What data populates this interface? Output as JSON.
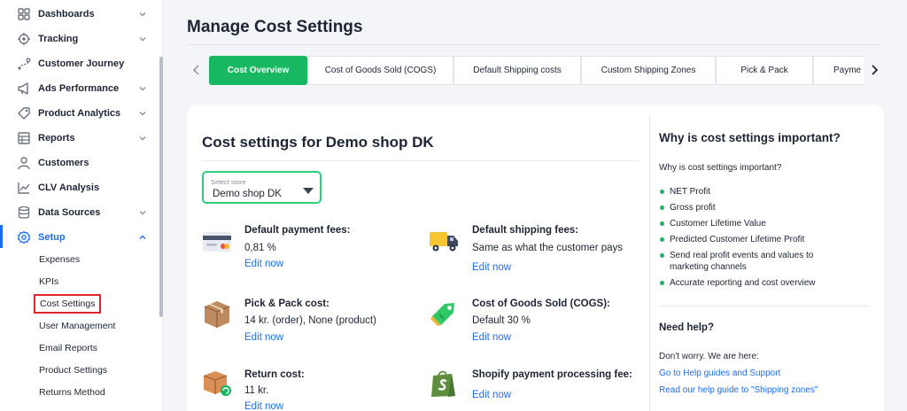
{
  "sidebar": {
    "items": [
      {
        "label": "Dashboards",
        "icon": "dashboards-icon",
        "has_chevron": true,
        "chevron": "down"
      },
      {
        "label": "Tracking",
        "icon": "tracking-icon",
        "has_chevron": true,
        "chevron": "down"
      },
      {
        "label": "Customer Journey",
        "icon": "customer-journey-icon",
        "has_chevron": false
      },
      {
        "label": "Ads Performance",
        "icon": "ads-performance-icon",
        "has_chevron": true,
        "chevron": "down"
      },
      {
        "label": "Product Analytics",
        "icon": "product-analytics-icon",
        "has_chevron": true,
        "chevron": "down"
      },
      {
        "label": "Reports",
        "icon": "reports-icon",
        "has_chevron": true,
        "chevron": "down"
      },
      {
        "label": "Customers",
        "icon": "customers-icon",
        "has_chevron": false
      },
      {
        "label": "CLV Analysis",
        "icon": "clv-analysis-icon",
        "has_chevron": false
      },
      {
        "label": "Data Sources",
        "icon": "data-sources-icon",
        "has_chevron": true,
        "chevron": "down"
      },
      {
        "label": "Setup",
        "icon": "setup-gear-icon",
        "has_chevron": true,
        "chevron": "up",
        "active": true
      }
    ],
    "setup_subitems": [
      {
        "label": "Expenses"
      },
      {
        "label": "KPIs"
      },
      {
        "label": "Cost Settings",
        "selected": true
      },
      {
        "label": "User Management"
      },
      {
        "label": "Email Reports"
      },
      {
        "label": "Product Settings"
      },
      {
        "label": "Returns Method"
      }
    ]
  },
  "page": {
    "title": "Manage Cost Settings"
  },
  "tabs": [
    {
      "label": "Cost Overview",
      "active": true
    },
    {
      "label": "Cost of Goods Sold (COGS)"
    },
    {
      "label": "Default Shipping costs"
    },
    {
      "label": "Custom Shipping Zones"
    },
    {
      "label": "Pick & Pack"
    },
    {
      "label": "Payme"
    }
  ],
  "card": {
    "title": "Cost settings for Demo shop DK",
    "store_select": {
      "caption": "Select store",
      "value": "Demo shop DK"
    },
    "items": [
      {
        "title": "Default payment fees:",
        "value": "0,81 %",
        "link": "Edit now",
        "icon": "payment-card-icon"
      },
      {
        "title": "Default shipping fees:",
        "value": "Same as what the customer pays",
        "link": "Edit now",
        "icon": "delivery-truck-icon"
      },
      {
        "title": "Pick & Pack cost:",
        "value": "14 kr. (order), None (product)",
        "link": "Edit now",
        "icon": "package-box-icon"
      },
      {
        "title": "Cost of Goods Sold (COGS):",
        "value": "Default 30 %",
        "link": "Edit now",
        "icon": "price-tag-icon"
      },
      {
        "title": "Return cost:",
        "value": "11 kr.",
        "link": "Edit now",
        "icon": "return-package-icon"
      },
      {
        "title": "Shopify payment processing fee:",
        "value": "",
        "link": "Edit now",
        "icon": "shopify-bag-icon"
      }
    ]
  },
  "right_panel": {
    "title": "Why is cost settings important?",
    "subtitle": "Why is cost settings important?",
    "list": [
      "NET Profit",
      "Gross profit",
      "Customer Lifetime Value",
      "Predicted Customer Lifetime Profit",
      "Send real profit events and values to marketing channels",
      "Accurate reporting and cost overview"
    ],
    "help_title": "Need help?",
    "help_text": "Don't worry. We are here:",
    "help_links": [
      "Go to Help guides and Support",
      "Read our help guide to \"Shipping zones\""
    ]
  },
  "colors": {
    "accent_green": "#17b861",
    "link_blue": "#1b6ef3",
    "selection_red": "#e0262a"
  }
}
